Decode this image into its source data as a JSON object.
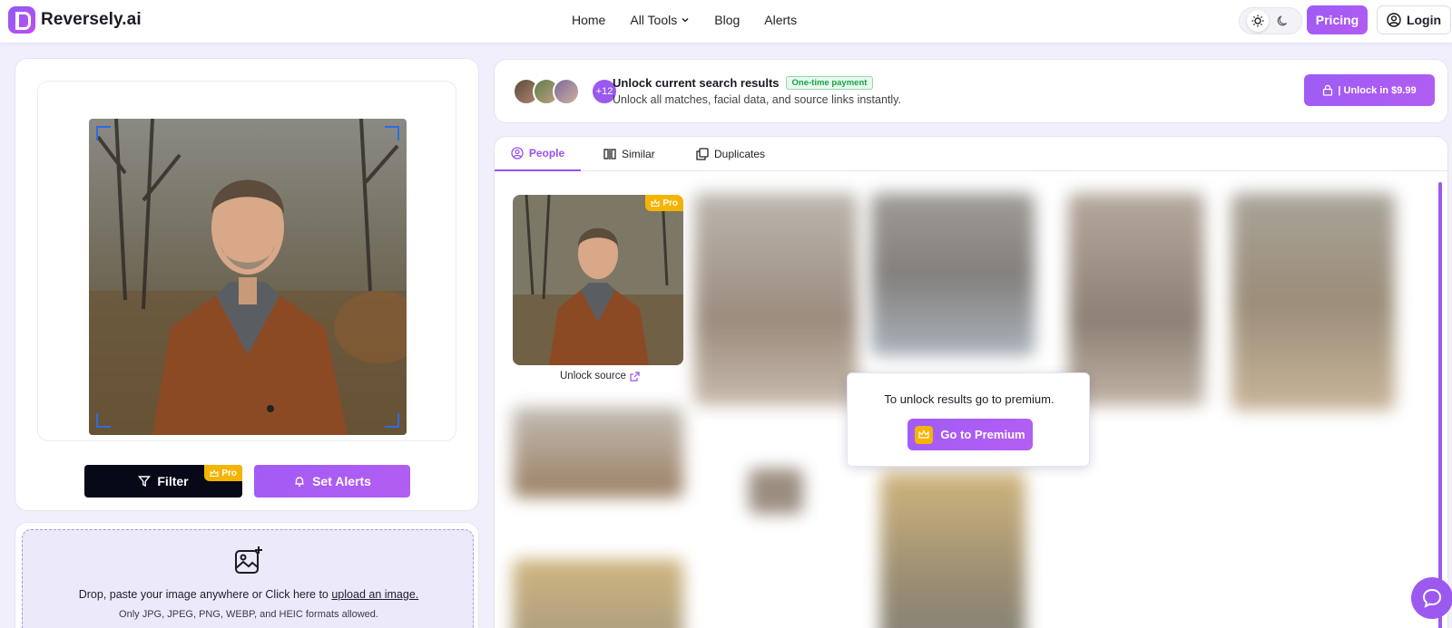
{
  "header": {
    "brand": "Reversely.ai",
    "nav": [
      "Home",
      "All Tools",
      "Blog",
      "Alerts"
    ],
    "pricing_label": "Pricing",
    "login_label": "Login"
  },
  "upload_panel": {
    "filter_label": "Filter",
    "filter_badge": "Pro",
    "alerts_label": "Set Alerts",
    "drop_text": "Drop, paste your image anywhere or Click here to",
    "drop_link": "upload an image.",
    "drop_formats": "Only JPG, JPEG, PNG, WEBP, and HEIC formats allowed."
  },
  "banner": {
    "avatar_count": "+12",
    "title": "Unlock current search results",
    "badge": "One-time payment",
    "subtitle": "Unlock all matches, facial data, and source links instantly.",
    "unlock_label": "| Unlock in $9.99"
  },
  "results": {
    "tabs": [
      "People",
      "Similar",
      "Duplicates"
    ],
    "active_tab": "People",
    "first_result_badge": "Pro",
    "unlock_source": "Unlock source",
    "premium_text": "To unlock results go to premium.",
    "premium_button": "Go to Premium"
  },
  "colors": {
    "accent": "#9b59f0",
    "pro_badge": "#f5b400",
    "dark_button": "#070818",
    "success": "#16a34a"
  }
}
